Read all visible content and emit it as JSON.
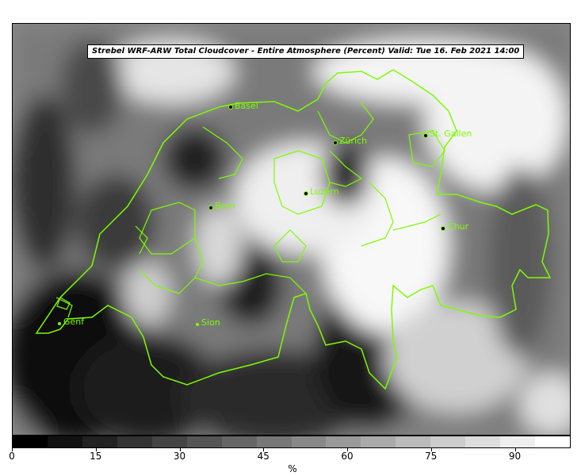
{
  "map": {
    "title": "Strebel WRF-ARW Total Cloudcover - Entire Atmosphere (Percent)   Valid: Tue 16. Feb 2021 14:00",
    "border_color": "#7cfc00",
    "cities": [
      {
        "name": "Basel"
      },
      {
        "name": "Zürich"
      },
      {
        "name": "St. Gallen"
      },
      {
        "name": "Luzern"
      },
      {
        "name": "Bern"
      },
      {
        "name": "Chur"
      },
      {
        "name": "Genf"
      },
      {
        "name": "Sion"
      }
    ]
  },
  "colorbar": {
    "unit": "%",
    "ticks": [
      "0",
      "15",
      "30",
      "45",
      "60",
      "75",
      "90"
    ],
    "range": [
      0,
      100
    ],
    "colors": [
      "#000000",
      "#111111",
      "#222222",
      "#333333",
      "#444444",
      "#555555",
      "#666666",
      "#777777",
      "#888888",
      "#999999",
      "#aaaaaa",
      "#bbbbbb",
      "#cccccc",
      "#dddddd",
      "#eeeeee",
      "#ffffff"
    ]
  }
}
